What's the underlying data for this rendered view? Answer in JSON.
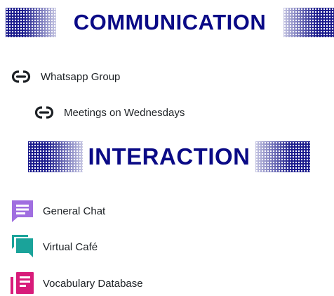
{
  "sections": [
    {
      "title": "COMMUNICATION"
    },
    {
      "title": "INTERACTION"
    }
  ],
  "communication_items": [
    {
      "label": "Whatsapp Group",
      "icon": "link-icon"
    },
    {
      "label": "Meetings on Wednesdays",
      "icon": "link-icon"
    }
  ],
  "interaction_items": [
    {
      "label": "General Chat",
      "icon": "chat-icon",
      "color": "#a06ee0"
    },
    {
      "label": "Virtual Café",
      "icon": "forum-icon",
      "color": "#1aa39a"
    },
    {
      "label": "Vocabulary Database",
      "icon": "database-icon",
      "color": "#d81b7a"
    }
  ],
  "colors": {
    "banner_text": "#0a0a86",
    "banner_pattern": "#1a1a8c",
    "text": "#1d2125"
  }
}
